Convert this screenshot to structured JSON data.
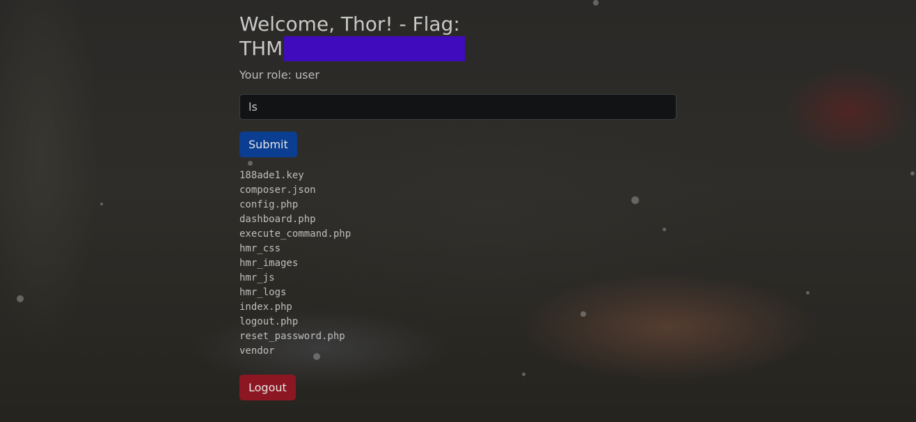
{
  "page": {
    "welcome_title": "Welcome, Thor! - Flag:",
    "flag_prefix": "THM",
    "role_text": "Your role: user"
  },
  "command": {
    "value": "ls",
    "submit_label": "Submit"
  },
  "output": {
    "files": [
      "188ade1.key",
      "composer.json",
      "config.php",
      "dashboard.php",
      "execute_command.php",
      "hmr_css",
      "hmr_images",
      "hmr_js",
      "hmr_logs",
      "index.php",
      "logout.php",
      "reset_password.php",
      "vendor"
    ]
  },
  "actions": {
    "logout_label": "Logout"
  },
  "colors": {
    "flag_redaction": "#3f0bbd",
    "submit_button": "#0b3d91",
    "logout_button": "#8c1723"
  }
}
